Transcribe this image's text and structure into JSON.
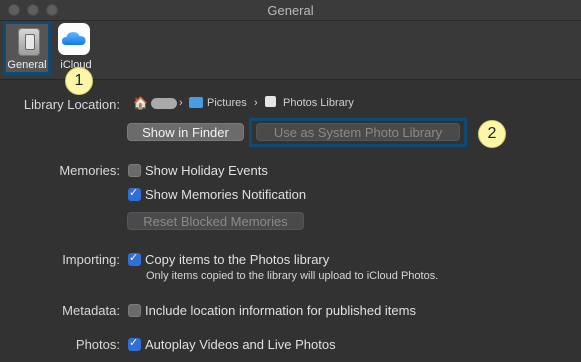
{
  "window": {
    "title": "General"
  },
  "toolbar": {
    "general_label": "General",
    "icloud_label": "iCloud"
  },
  "callouts": {
    "one": "1",
    "two": "2"
  },
  "library": {
    "label": "Library Location:",
    "path": [
      "Pictures",
      "Photos Library"
    ],
    "separator": "›",
    "show_in_finder": "Show in Finder",
    "use_as_system": "Use as System Photo Library"
  },
  "memories": {
    "label": "Memories:",
    "show_holiday_events": {
      "label": "Show Holiday Events",
      "checked": false
    },
    "show_memories_notification": {
      "label": "Show Memories Notification",
      "checked": true
    },
    "reset_blocked": "Reset Blocked Memories"
  },
  "importing": {
    "label": "Importing:",
    "copy_items": {
      "label": "Copy items to the Photos library",
      "checked": true
    },
    "note": "Only items copied to the library will upload to iCloud Photos."
  },
  "metadata": {
    "label": "Metadata:",
    "include_location": {
      "label": "Include location information for published items",
      "checked": false
    }
  },
  "photos": {
    "label": "Photos:",
    "autoplay": {
      "label": "Autoplay Videos and Live Photos",
      "checked": true
    }
  },
  "colors": {
    "accent": "#2f6fd6",
    "highlight": "#0f4a73",
    "callout": "#fdf5a8"
  }
}
